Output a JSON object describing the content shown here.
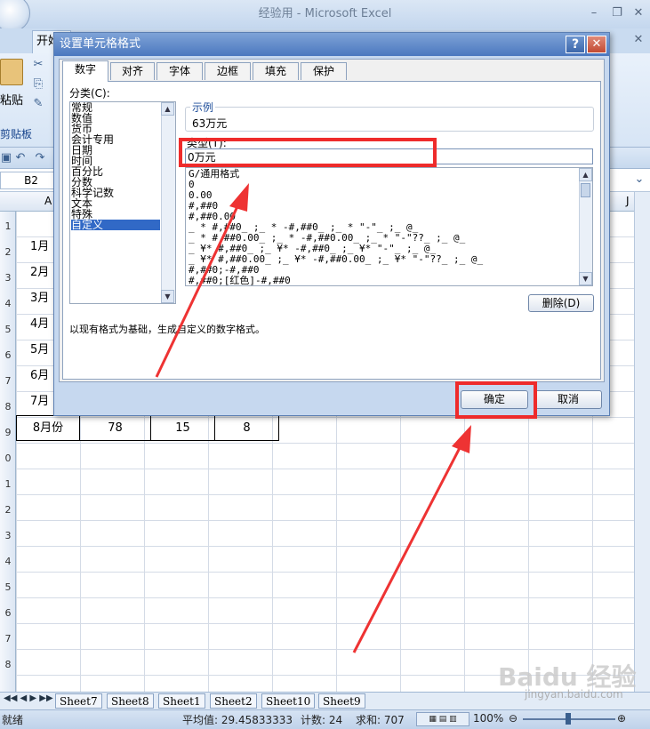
{
  "window": {
    "title": "经验用 - Microsoft Excel",
    "minimize": "–",
    "restore": "❐",
    "close": "✕",
    "ribbon_close": "✕"
  },
  "ribbon": {
    "home_tab": "开始",
    "paste": "粘贴",
    "clipboard": "剪贴板",
    "tools": {
      "cut": "✂",
      "copy": "⎘",
      "format_painter": "✎"
    }
  },
  "qat": {
    "save": "▣",
    "undo": "↶",
    "redo": "↷"
  },
  "formula_bar": {
    "namebox": "B2"
  },
  "columns": [
    "A",
    "J"
  ],
  "rows": [
    "1",
    "2",
    "3",
    "4",
    "5",
    "6",
    "7",
    "8",
    "9",
    "0",
    "1",
    "2",
    "3",
    "4",
    "5",
    "6",
    "7",
    "8"
  ],
  "month_cells": [
    "1月",
    "2月",
    "3月",
    "4月",
    "5月",
    "6月",
    "7月"
  ],
  "row8": [
    "8月份",
    "78",
    "15",
    "8"
  ],
  "sheets": [
    "Sheet7",
    "Sheet8",
    "Sheet1",
    "Sheet2",
    "Sheet10",
    "Sheet9"
  ],
  "status": {
    "ready": "就绪",
    "average": "平均值: 29.45833333",
    "count": "计数: 24",
    "sum": "求和: 707",
    "zoom": "100%"
  },
  "dialog": {
    "title": "设置单元格格式",
    "help": "?",
    "close": "✕",
    "tabs": [
      "数字",
      "对齐",
      "字体",
      "边框",
      "填充",
      "保护"
    ],
    "category_label": "分类(C):",
    "categories": [
      "常规",
      "数值",
      "货币",
      "会计专用",
      "日期",
      "时间",
      "百分比",
      "分数",
      "科学记数",
      "文本",
      "特殊",
      "自定义"
    ],
    "sample_label": "示例",
    "sample_value": "63万元",
    "type_label": "类型(T):",
    "type_value": "0万元",
    "formats": [
      "G/通用格式",
      "0",
      "0.00",
      "#,##0",
      "#,##0.00",
      "_ * #,##0_ ;_ * -#,##0_ ;_ * \"-\"_ ;_ @_",
      "_ * #,##0.00_ ;_ * -#,##0.00_ ;_ * \"-\"??_ ;_ @_",
      "_ ¥* #,##0_ ;_ ¥* -#,##0_ ;_ ¥* \"-\"_ ;_ @_",
      "_ ¥* #,##0.00_ ;_ ¥* -#,##0.00_ ;_ ¥* \"-\"??_ ;_ @_",
      "#,##0;-#,##0",
      "#,##0;[红色]-#,##0"
    ],
    "delete_button": "删除(D)",
    "description": "以现有格式为基础，生成自定义的数字格式。",
    "ok_button": "确定",
    "cancel_button": "取消"
  },
  "watermark": {
    "logo": "Baidu 经验",
    "url": "jingyan.baidu.com"
  }
}
